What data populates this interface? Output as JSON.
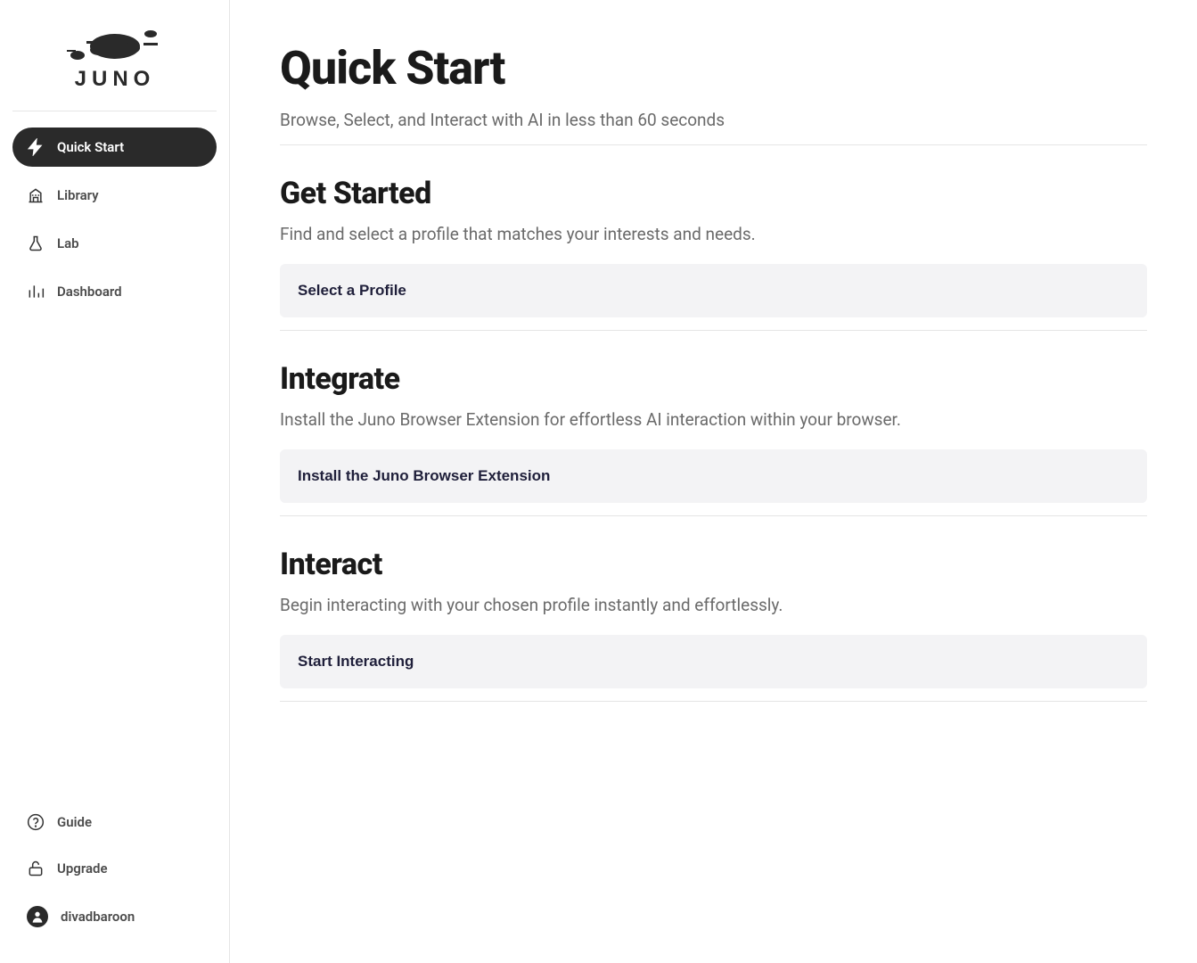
{
  "brand": "JUNO",
  "sidebar": {
    "nav": [
      {
        "label": "Quick Start",
        "active": true
      },
      {
        "label": "Library",
        "active": false
      },
      {
        "label": "Lab",
        "active": false
      },
      {
        "label": "Dashboard",
        "active": false
      }
    ],
    "bottom": [
      {
        "label": "Guide"
      },
      {
        "label": "Upgrade"
      },
      {
        "label": "divadbaroon"
      }
    ]
  },
  "page": {
    "title": "Quick Start",
    "subtitle": "Browse, Select, and Interact with AI in less than 60 seconds",
    "sections": [
      {
        "title": "Get Started",
        "desc": "Find and select a profile that matches your interests and needs.",
        "action": "Select a Profile"
      },
      {
        "title": "Integrate",
        "desc": "Install the Juno Browser Extension for effortless AI interaction within your browser.",
        "action": "Install the Juno Browser Extension"
      },
      {
        "title": "Interact",
        "desc": "Begin interacting with your chosen profile instantly and effortlessly.",
        "action": "Start Interacting"
      }
    ]
  }
}
